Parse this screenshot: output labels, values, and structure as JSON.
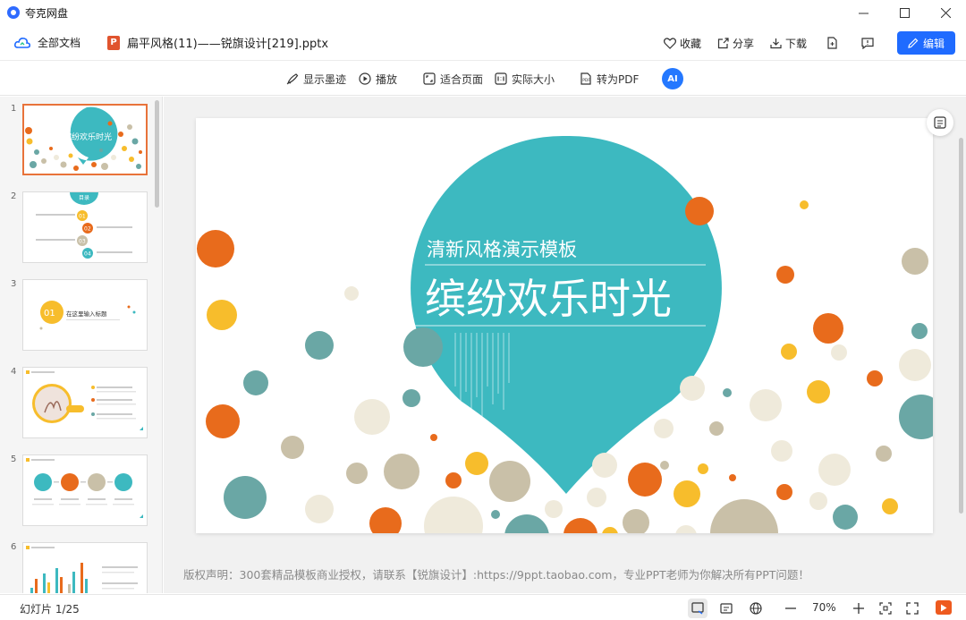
{
  "app": {
    "title": "夸克网盘"
  },
  "window": {
    "minimize": "—",
    "maximize": "☐",
    "close": "✕"
  },
  "header": {
    "all_docs": "全部文档",
    "file_name": "扁平风格(11)——锐旗设计[219].pptx",
    "favorite": "收藏",
    "share": "分享",
    "download": "下载",
    "edit": "编辑"
  },
  "toolbar": {
    "show_ink": "显示墨迹",
    "play": "播放",
    "fit_page": "适合页面",
    "actual_size": "实际大小",
    "to_pdf": "转为PDF",
    "ai": "AI"
  },
  "sidebar": {
    "thumbnails": [
      {
        "num": "1",
        "title": "缤纷欢乐时光"
      },
      {
        "num": "2",
        "title": "目录",
        "items": [
          "01",
          "02",
          "03",
          "04"
        ]
      },
      {
        "num": "3",
        "badge": "01",
        "title": "在这里输入标题"
      },
      {
        "num": "4"
      },
      {
        "num": "5"
      },
      {
        "num": "6"
      }
    ]
  },
  "slide": {
    "subtitle": "清新风格演示模板",
    "title": "缤纷欢乐时光",
    "colors": {
      "teal": "#3db9c0",
      "orange": "#e86b1c",
      "yellow": "#f7bd2c",
      "gray_teal": "#6aa7a5",
      "beige": "#c9c0a8",
      "cream": "#efeadb"
    }
  },
  "copyright": "版权声明：300套精品模板商业授权，请联系【锐旗设计】:https://9ppt.taobao.com，专业PPT老师为你解决所有PPT问题！",
  "statusbar": {
    "slide_count": "幻灯片 1/25",
    "zoom": "70%",
    "zoom_out": "—",
    "zoom_in": "+"
  }
}
